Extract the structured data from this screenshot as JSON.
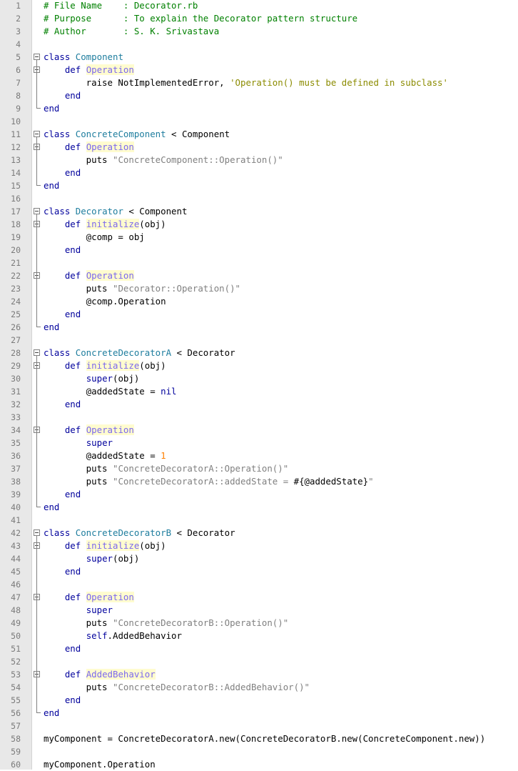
{
  "editor": {
    "language": "ruby",
    "lines": [
      {
        "n": "1",
        "fold": "",
        "tokens": [
          [
            "cm",
            "# File Name    : Decorator.rb"
          ]
        ]
      },
      {
        "n": "2",
        "fold": "",
        "tokens": [
          [
            "cm",
            "# Purpose      : To explain the Decorator pattern structure"
          ]
        ]
      },
      {
        "n": "3",
        "fold": "",
        "tokens": [
          [
            "cm",
            "# Author       : S. K. Srivastava"
          ]
        ]
      },
      {
        "n": "4",
        "fold": "",
        "tokens": []
      },
      {
        "n": "5",
        "fold": "open",
        "tokens": [
          [
            "kw",
            "class "
          ],
          [
            "cls",
            "Component"
          ]
        ]
      },
      {
        "n": "6",
        "fold": "open-inner",
        "tokens": [
          [
            "",
            "    "
          ],
          [
            "kw",
            "def "
          ],
          [
            "fn",
            "Operation"
          ]
        ]
      },
      {
        "n": "7",
        "fold": "",
        "tokens": [
          [
            "",
            "        raise NotImplementedError, "
          ],
          [
            "sq",
            "'Operation() must be defined in subclass'"
          ]
        ]
      },
      {
        "n": "8",
        "fold": "",
        "tokens": [
          [
            "",
            "    "
          ],
          [
            "kw",
            "end"
          ]
        ]
      },
      {
        "n": "9",
        "fold": "end",
        "tokens": [
          [
            "kw",
            "end"
          ]
        ]
      },
      {
        "n": "10",
        "fold": "",
        "tokens": []
      },
      {
        "n": "11",
        "fold": "open",
        "tokens": [
          [
            "kw",
            "class "
          ],
          [
            "cls",
            "ConcreteComponent"
          ],
          [
            "",
            " < Component"
          ]
        ]
      },
      {
        "n": "12",
        "fold": "open-inner",
        "tokens": [
          [
            "",
            "    "
          ],
          [
            "kw",
            "def "
          ],
          [
            "fn",
            "Operation"
          ]
        ]
      },
      {
        "n": "13",
        "fold": "",
        "tokens": [
          [
            "",
            "        puts "
          ],
          [
            "str",
            "\"ConcreteComponent::Operation()\""
          ]
        ]
      },
      {
        "n": "14",
        "fold": "",
        "tokens": [
          [
            "",
            "    "
          ],
          [
            "kw",
            "end"
          ]
        ]
      },
      {
        "n": "15",
        "fold": "end",
        "tokens": [
          [
            "kw",
            "end"
          ]
        ]
      },
      {
        "n": "16",
        "fold": "",
        "tokens": []
      },
      {
        "n": "17",
        "fold": "open",
        "tokens": [
          [
            "kw",
            "class "
          ],
          [
            "cls",
            "Decorator"
          ],
          [
            "",
            " < Component"
          ]
        ]
      },
      {
        "n": "18",
        "fold": "open-inner",
        "tokens": [
          [
            "",
            "    "
          ],
          [
            "kw",
            "def "
          ],
          [
            "fn",
            "initialize"
          ],
          [
            "",
            "(obj)"
          ]
        ]
      },
      {
        "n": "19",
        "fold": "",
        "tokens": [
          [
            "",
            "        @comp = obj"
          ]
        ]
      },
      {
        "n": "20",
        "fold": "",
        "tokens": [
          [
            "",
            "    "
          ],
          [
            "kw",
            "end"
          ]
        ]
      },
      {
        "n": "21",
        "fold": "",
        "tokens": []
      },
      {
        "n": "22",
        "fold": "open-inner",
        "tokens": [
          [
            "",
            "    "
          ],
          [
            "kw",
            "def "
          ],
          [
            "fn",
            "Operation"
          ]
        ]
      },
      {
        "n": "23",
        "fold": "",
        "tokens": [
          [
            "",
            "        puts "
          ],
          [
            "str",
            "\"Decorator::Operation()\""
          ]
        ]
      },
      {
        "n": "24",
        "fold": "",
        "tokens": [
          [
            "",
            "        @comp.Operation"
          ]
        ]
      },
      {
        "n": "25",
        "fold": "",
        "tokens": [
          [
            "",
            "    "
          ],
          [
            "kw",
            "end"
          ]
        ]
      },
      {
        "n": "26",
        "fold": "end",
        "tokens": [
          [
            "kw",
            "end"
          ]
        ]
      },
      {
        "n": "27",
        "fold": "",
        "tokens": []
      },
      {
        "n": "28",
        "fold": "open",
        "tokens": [
          [
            "kw",
            "class "
          ],
          [
            "cls",
            "ConcreteDecoratorA"
          ],
          [
            "",
            " < Decorator"
          ]
        ]
      },
      {
        "n": "29",
        "fold": "open-inner",
        "tokens": [
          [
            "",
            "    "
          ],
          [
            "kw",
            "def "
          ],
          [
            "fn",
            "initialize"
          ],
          [
            "",
            "(obj)"
          ]
        ]
      },
      {
        "n": "30",
        "fold": "",
        "tokens": [
          [
            "",
            "        "
          ],
          [
            "kw",
            "super"
          ],
          [
            "",
            "(obj)"
          ]
        ]
      },
      {
        "n": "31",
        "fold": "",
        "tokens": [
          [
            "",
            "        @addedState = "
          ],
          [
            "kw",
            "nil"
          ]
        ]
      },
      {
        "n": "32",
        "fold": "",
        "tokens": [
          [
            "",
            "    "
          ],
          [
            "kw",
            "end"
          ]
        ]
      },
      {
        "n": "33",
        "fold": "",
        "tokens": []
      },
      {
        "n": "34",
        "fold": "open-inner",
        "tokens": [
          [
            "",
            "    "
          ],
          [
            "kw",
            "def "
          ],
          [
            "fn",
            "Operation"
          ]
        ]
      },
      {
        "n": "35",
        "fold": "",
        "tokens": [
          [
            "",
            "        "
          ],
          [
            "kw",
            "super"
          ]
        ]
      },
      {
        "n": "36",
        "fold": "",
        "tokens": [
          [
            "",
            "        @addedState = "
          ],
          [
            "num",
            "1"
          ]
        ]
      },
      {
        "n": "37",
        "fold": "",
        "tokens": [
          [
            "",
            "        puts "
          ],
          [
            "str",
            "\"ConcreteDecoratorA::Operation()\""
          ]
        ]
      },
      {
        "n": "38",
        "fold": "",
        "tokens": [
          [
            "",
            "        puts "
          ],
          [
            "str",
            "\"ConcreteDecoratorA::addedState = "
          ],
          [
            "interp",
            "#{@addedState}"
          ],
          [
            "str",
            "\""
          ]
        ]
      },
      {
        "n": "39",
        "fold": "",
        "tokens": [
          [
            "",
            "    "
          ],
          [
            "kw",
            "end"
          ]
        ]
      },
      {
        "n": "40",
        "fold": "end",
        "tokens": [
          [
            "kw",
            "end"
          ]
        ]
      },
      {
        "n": "41",
        "fold": "",
        "tokens": []
      },
      {
        "n": "42",
        "fold": "open",
        "tokens": [
          [
            "kw",
            "class "
          ],
          [
            "cls",
            "ConcreteDecoratorB"
          ],
          [
            "",
            " < Decorator"
          ]
        ]
      },
      {
        "n": "43",
        "fold": "open-inner",
        "tokens": [
          [
            "",
            "    "
          ],
          [
            "kw",
            "def "
          ],
          [
            "fn",
            "initialize"
          ],
          [
            "",
            "(obj)"
          ]
        ]
      },
      {
        "n": "44",
        "fold": "",
        "tokens": [
          [
            "",
            "        "
          ],
          [
            "kw",
            "super"
          ],
          [
            "",
            "(obj)"
          ]
        ]
      },
      {
        "n": "45",
        "fold": "",
        "tokens": [
          [
            "",
            "    "
          ],
          [
            "kw",
            "end"
          ]
        ]
      },
      {
        "n": "46",
        "fold": "",
        "tokens": []
      },
      {
        "n": "47",
        "fold": "open-inner",
        "tokens": [
          [
            "",
            "    "
          ],
          [
            "kw",
            "def "
          ],
          [
            "fn",
            "Operation"
          ]
        ]
      },
      {
        "n": "48",
        "fold": "",
        "tokens": [
          [
            "",
            "        "
          ],
          [
            "kw",
            "super"
          ]
        ]
      },
      {
        "n": "49",
        "fold": "",
        "tokens": [
          [
            "",
            "        puts "
          ],
          [
            "str",
            "\"ConcreteDecoratorB::Operation()\""
          ]
        ]
      },
      {
        "n": "50",
        "fold": "",
        "tokens": [
          [
            "",
            "        "
          ],
          [
            "kw",
            "self"
          ],
          [
            "",
            ".AddedBehavior"
          ]
        ]
      },
      {
        "n": "51",
        "fold": "",
        "tokens": [
          [
            "",
            "    "
          ],
          [
            "kw",
            "end"
          ]
        ]
      },
      {
        "n": "52",
        "fold": "",
        "tokens": []
      },
      {
        "n": "53",
        "fold": "open-inner",
        "tokens": [
          [
            "",
            "    "
          ],
          [
            "kw",
            "def "
          ],
          [
            "fn",
            "AddedBehavior"
          ]
        ]
      },
      {
        "n": "54",
        "fold": "",
        "tokens": [
          [
            "",
            "        puts "
          ],
          [
            "str",
            "\"ConcreteDecoratorB::AddedBehavior()\""
          ]
        ]
      },
      {
        "n": "55",
        "fold": "",
        "tokens": [
          [
            "",
            "    "
          ],
          [
            "kw",
            "end"
          ]
        ]
      },
      {
        "n": "56",
        "fold": "end",
        "tokens": [
          [
            "kw",
            "end"
          ]
        ]
      },
      {
        "n": "57",
        "fold": "",
        "tokens": []
      },
      {
        "n": "58",
        "fold": "",
        "tokens": [
          [
            "",
            "myComponent = ConcreteDecoratorA.new(ConcreteDecoratorB.new(ConcreteComponent.new))"
          ]
        ]
      },
      {
        "n": "59",
        "fold": "",
        "tokens": []
      },
      {
        "n": "60",
        "fold": "",
        "tokens": [
          [
            "",
            "myComponent.Operation"
          ]
        ]
      }
    ],
    "colors": {
      "comment": "#008000",
      "keyword": "#00009c",
      "class_name": "#1e7d9e",
      "method_name": "#7b68ee",
      "method_highlight": "#fffccf",
      "double_string": "#808080",
      "single_string": "#8b8b00",
      "number": "#ff8000",
      "gutter_bg": "#e8e8e8",
      "line_number": "#7a7a7a"
    }
  }
}
